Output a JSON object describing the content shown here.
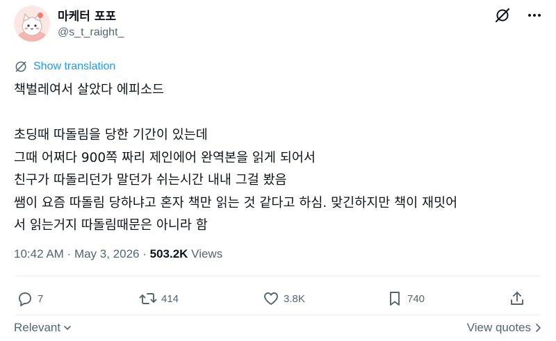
{
  "user": {
    "display_name": "마케터 포포",
    "handle": "@s_t_raight_",
    "avatar_icon": "cartoon-cat-avatar"
  },
  "header_icons": [
    "grok-icon",
    "more-icon"
  ],
  "translate": {
    "label": "Show translation",
    "icon": "translate-globe-icon"
  },
  "tweet": {
    "lines": [
      "책벌레여서 살았다 에피소드",
      "",
      "초딩때 따돌림을 당한 기간이 있는데",
      "그때 어쩌다 900쪽 짜리 제인에어 완역본을 읽게 되어서",
      "친구가 따돌리던가 말던가 쉬는시간 내내 그걸 봤음",
      "쌤이 요즘 따돌림 당하냐고 혼자 책만 읽는 것 같다고 하심. 맞긴하지만 책이 재밋어",
      "서 읽는거지 따돌림때문은 아니라 함"
    ]
  },
  "meta": {
    "time": "10:42 AM",
    "sep1": " · ",
    "date": "May 3, 2026",
    "sep2": " · ",
    "views_count": "503.2K",
    "views_label": " Views"
  },
  "actions": {
    "replies": "7",
    "reposts": "414",
    "likes": "3.8K",
    "bookmarks": "740"
  },
  "bottom": {
    "sort_label": "Relevant",
    "view_quotes_label": "View quotes"
  },
  "colors": {
    "text": "#0f1419",
    "muted": "#536471",
    "accent": "#1d9bf0",
    "divider": "#eff3f4"
  }
}
